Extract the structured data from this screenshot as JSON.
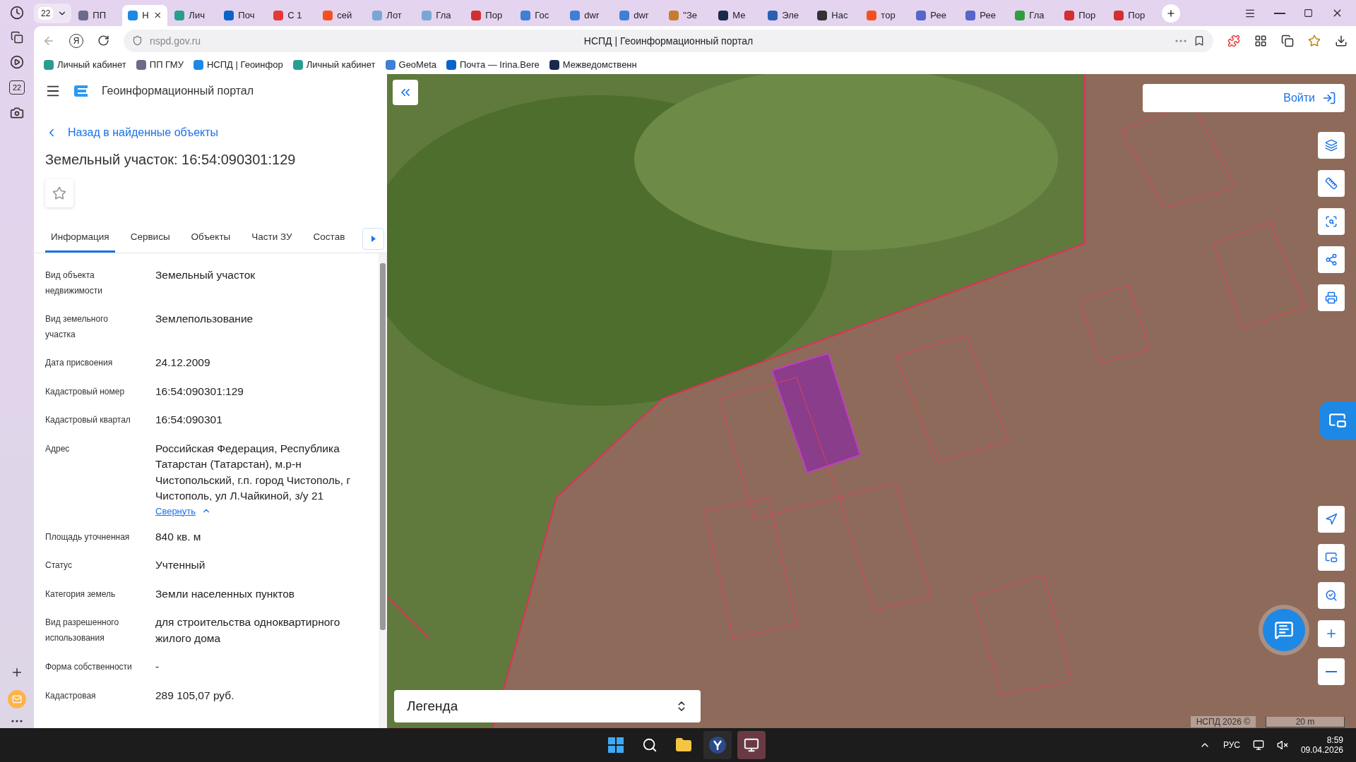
{
  "browser": {
    "tab_counter": "22",
    "sidebar_calendar": "22",
    "tabs": [
      {
        "label": "ПП",
        "selected": false,
        "color": "#6b6b8a"
      },
      {
        "label": "Н",
        "selected": true,
        "color": "#1e88e5"
      },
      {
        "label": "Лич",
        "selected": false,
        "color": "#2a9d8f"
      },
      {
        "label": "Поч",
        "selected": false,
        "color": "#0a64c8"
      },
      {
        "label": "С 1",
        "selected": false,
        "color": "#e53935"
      },
      {
        "label": "сей",
        "selected": false,
        "color": "#f4511e"
      },
      {
        "label": "Лот",
        "selected": false,
        "color": "#7aa6d6"
      },
      {
        "label": "Гла",
        "selected": false,
        "color": "#7aa6d6"
      },
      {
        "label": "Пор",
        "selected": false,
        "color": "#d32f2f"
      },
      {
        "label": "Гос",
        "selected": false,
        "color": "#3f7fd6"
      },
      {
        "label": "dwr",
        "selected": false,
        "color": "#3f7fd6"
      },
      {
        "label": "dwr",
        "selected": false,
        "color": "#3f7fd6"
      },
      {
        "label": "\"Зе",
        "selected": false,
        "color": "#c77b30"
      },
      {
        "label": "Ме",
        "selected": false,
        "color": "#1a2a4a"
      },
      {
        "label": "Эле",
        "selected": false,
        "color": "#2b5fb4"
      },
      {
        "label": "Нас",
        "selected": false,
        "color": "#333333"
      },
      {
        "label": "тор",
        "selected": false,
        "color": "#f4511e"
      },
      {
        "label": "Рее",
        "selected": false,
        "color": "#5566cc"
      },
      {
        "label": "Рее",
        "selected": false,
        "color": "#5566cc"
      },
      {
        "label": "Гла",
        "selected": false,
        "color": "#2e9e3e"
      },
      {
        "label": "Пор",
        "selected": false,
        "color": "#d32f2f"
      },
      {
        "label": "Пор",
        "selected": false,
        "color": "#d32f2f"
      }
    ],
    "yandex_logo": "Я",
    "url": "nspd.gov.ru",
    "page_title": "НСПД | Геоинформационный портал",
    "bookmarks": [
      {
        "label": "Личный кабинет",
        "color": "#2a9d8f"
      },
      {
        "label": "ПП ГМУ",
        "color": "#6b6b8a"
      },
      {
        "label": "НСПД | Геоинфор",
        "color": "#1e88e5"
      },
      {
        "label": "Личный кабинет",
        "color": "#2a9d8f"
      },
      {
        "label": "GeoMeta",
        "color": "#3f7fd6"
      },
      {
        "label": "Почта — Irina.Bere",
        "color": "#0a64c8"
      },
      {
        "label": "Межведомственн",
        "color": "#1a2a4a"
      }
    ]
  },
  "portal": {
    "title": "Геоинформационный портал",
    "back_link": "Назад в найденные объекты",
    "heading": "Земельный участок: 16:54:090301:129",
    "favorite": false,
    "tabs": [
      {
        "label": "Информация",
        "selected": true
      },
      {
        "label": "Сервисы",
        "selected": false
      },
      {
        "label": "Объекты",
        "selected": false
      },
      {
        "label": "Части ЗУ",
        "selected": false
      },
      {
        "label": "Состав",
        "selected": false
      }
    ],
    "properties": [
      {
        "label": "Вид объекта недвижимости",
        "value": "Земельный участок"
      },
      {
        "label": "Вид земельного участка",
        "value": "Землепользование"
      },
      {
        "label": "Дата присвоения",
        "value": "24.12.2009"
      },
      {
        "label": "Кадастровый номер",
        "value": "16:54:090301:129"
      },
      {
        "label": "Кадастровый квартал",
        "value": "16:54:090301"
      },
      {
        "label": "Адрес",
        "value": "Российская Федерация, Республика Татарстан (Татарстан), м.р-н Чистопольский, г.п. город Чистополь, г Чистополь, ул Л.Чайкиной, з/у 21",
        "collapse_link": "Свернуть"
      },
      {
        "label": "Площадь уточненная",
        "value": "840 кв. м"
      },
      {
        "label": "Статус",
        "value": "Учтенный"
      },
      {
        "label": "Категория земель",
        "value": "Земли населенных пунктов"
      },
      {
        "label": "Вид разрешенного использования",
        "value": "для строительства одноквартирного жилого дома"
      },
      {
        "label": "Форма собственности",
        "value": "-"
      },
      {
        "label": "Кадастровая",
        "value": "289 105,07 руб."
      }
    ]
  },
  "map": {
    "login": "Войти",
    "legend": "Легенда",
    "attribution": "НСПД 2026 ©",
    "scale": "20 m"
  },
  "taskbar": {
    "language": "РУС",
    "time": "8:59",
    "date": "09.04.2026"
  }
}
